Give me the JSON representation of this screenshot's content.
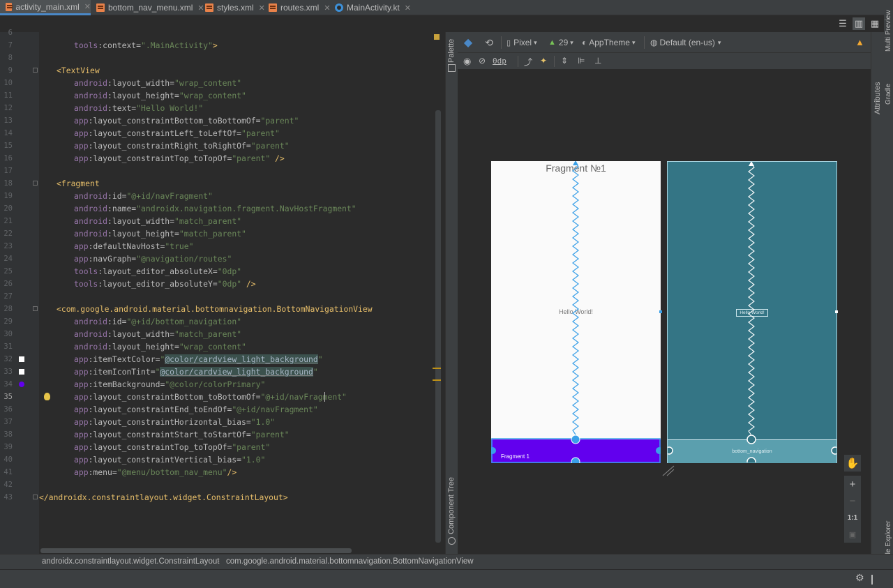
{
  "tabs": [
    {
      "label": "activity_main.xml",
      "icon": "xml-file-icon",
      "active": true
    },
    {
      "label": "bottom_nav_menu.xml",
      "icon": "xml-file-icon",
      "active": false
    },
    {
      "label": "styles.xml",
      "icon": "xml-file-icon",
      "active": false
    },
    {
      "label": "routes.xml",
      "icon": "xml-file-icon",
      "active": false
    },
    {
      "label": "MainActivity.kt",
      "icon": "kotlin-file-icon",
      "active": false
    }
  ],
  "editor": {
    "current_line": "35",
    "lines": [
      {
        "n": "6",
        "segs": []
      },
      {
        "n": "7",
        "segs": [
          [
            "ns",
            "tools"
          ],
          [
            "attr",
            ":context="
          ],
          [
            "val",
            "\".MainActivity\""
          ],
          [
            "tag",
            ">"
          ]
        ]
      },
      {
        "n": "8",
        "segs": []
      },
      {
        "n": "9",
        "segs": [
          [
            "tag",
            "<TextView"
          ]
        ]
      },
      {
        "n": "10",
        "segs": [
          [
            "ns",
            "android"
          ],
          [
            "attr",
            ":layout_width="
          ],
          [
            "val",
            "\"wrap_content\""
          ]
        ]
      },
      {
        "n": "11",
        "segs": [
          [
            "ns",
            "android"
          ],
          [
            "attr",
            ":layout_height="
          ],
          [
            "val",
            "\"wrap_content\""
          ]
        ]
      },
      {
        "n": "12",
        "segs": [
          [
            "ns",
            "android"
          ],
          [
            "attr",
            ":text="
          ],
          [
            "val",
            "\"Hello World!\""
          ]
        ]
      },
      {
        "n": "13",
        "segs": [
          [
            "ns",
            "app"
          ],
          [
            "attr",
            ":layout_constraintBottom_toBottomOf="
          ],
          [
            "val",
            "\"parent\""
          ]
        ]
      },
      {
        "n": "14",
        "segs": [
          [
            "ns",
            "app"
          ],
          [
            "attr",
            ":layout_constraintLeft_toLeftOf="
          ],
          [
            "val",
            "\"parent\""
          ]
        ]
      },
      {
        "n": "15",
        "segs": [
          [
            "ns",
            "app"
          ],
          [
            "attr",
            ":layout_constraintRight_toRightOf="
          ],
          [
            "val",
            "\"parent\""
          ]
        ]
      },
      {
        "n": "16",
        "segs": [
          [
            "ns",
            "app"
          ],
          [
            "attr",
            ":layout_constraintTop_toTopOf="
          ],
          [
            "val",
            "\"parent\""
          ],
          [
            "tag",
            " />"
          ]
        ]
      },
      {
        "n": "17",
        "segs": []
      },
      {
        "n": "18",
        "segs": [
          [
            "tag",
            "<fragment"
          ]
        ]
      },
      {
        "n": "19",
        "segs": [
          [
            "ns",
            "android"
          ],
          [
            "attr",
            ":id="
          ],
          [
            "val",
            "\"@+id/navFragment\""
          ]
        ]
      },
      {
        "n": "20",
        "segs": [
          [
            "ns",
            "android"
          ],
          [
            "attr",
            ":name="
          ],
          [
            "val",
            "\"androidx.navigation.fragment.NavHostFragment\""
          ]
        ]
      },
      {
        "n": "21",
        "segs": [
          [
            "ns",
            "android"
          ],
          [
            "attr",
            ":layout_width="
          ],
          [
            "val",
            "\"match_parent\""
          ]
        ]
      },
      {
        "n": "22",
        "segs": [
          [
            "ns",
            "android"
          ],
          [
            "attr",
            ":layout_height="
          ],
          [
            "val",
            "\"match_parent\""
          ]
        ]
      },
      {
        "n": "23",
        "segs": [
          [
            "ns",
            "app"
          ],
          [
            "attr",
            ":defaultNavHost="
          ],
          [
            "val",
            "\"true\""
          ]
        ]
      },
      {
        "n": "24",
        "segs": [
          [
            "ns",
            "app"
          ],
          [
            "attr",
            ":navGraph="
          ],
          [
            "val",
            "\"@navigation/routes\""
          ]
        ]
      },
      {
        "n": "25",
        "segs": [
          [
            "ns",
            "tools"
          ],
          [
            "attr",
            ":layout_editor_absoluteX="
          ],
          [
            "val",
            "\"0dp\""
          ]
        ]
      },
      {
        "n": "26",
        "segs": [
          [
            "ns",
            "tools"
          ],
          [
            "attr",
            ":layout_editor_absoluteY="
          ],
          [
            "val",
            "\"0dp\""
          ],
          [
            "tag",
            " />"
          ]
        ]
      },
      {
        "n": "27",
        "segs": []
      },
      {
        "n": "28",
        "segs": [
          [
            "tag",
            "<com.google.android.material.bottomnavigation.BottomNavigationView"
          ]
        ]
      },
      {
        "n": "29",
        "segs": [
          [
            "ns",
            "android"
          ],
          [
            "attr",
            ":id="
          ],
          [
            "val",
            "\"@+id/bottom_navigation\""
          ]
        ]
      },
      {
        "n": "30",
        "segs": [
          [
            "ns",
            "android"
          ],
          [
            "attr",
            ":layout_width="
          ],
          [
            "val",
            "\"match_parent\""
          ]
        ]
      },
      {
        "n": "31",
        "segs": [
          [
            "ns",
            "android"
          ],
          [
            "attr",
            ":layout_height="
          ],
          [
            "val",
            "\"wrap_content\""
          ]
        ]
      },
      {
        "n": "32",
        "segs": [
          [
            "ns",
            "app"
          ],
          [
            "attr",
            ":itemTextColor="
          ],
          [
            "val",
            "\""
          ],
          [
            "hl",
            "@color/cardview_light_background"
          ],
          [
            "val",
            "\""
          ]
        ]
      },
      {
        "n": "33",
        "segs": [
          [
            "ns",
            "app"
          ],
          [
            "attr",
            ":itemIconTint="
          ],
          [
            "val",
            "\""
          ],
          [
            "hl",
            "@color/cardview_light_background"
          ],
          [
            "val",
            "\""
          ]
        ]
      },
      {
        "n": "34",
        "segs": [
          [
            "ns",
            "app"
          ],
          [
            "attr",
            ":itemBackground="
          ],
          [
            "val",
            "\"@color/colorPrimary\""
          ]
        ]
      },
      {
        "n": "35",
        "segs": [
          [
            "ns",
            "app"
          ],
          [
            "attr",
            ":layout_constraintBottom_toBottomOf="
          ],
          [
            "val",
            "\"@+id/navFragment\""
          ]
        ]
      },
      {
        "n": "36",
        "segs": [
          [
            "ns",
            "app"
          ],
          [
            "attr",
            ":layout_constraintEnd_toEndOf="
          ],
          [
            "val",
            "\"@+id/navFragment\""
          ]
        ]
      },
      {
        "n": "37",
        "segs": [
          [
            "ns",
            "app"
          ],
          [
            "attr",
            ":layout_constraintHorizontal_bias="
          ],
          [
            "val",
            "\"1.0\""
          ]
        ]
      },
      {
        "n": "38",
        "segs": [
          [
            "ns",
            "app"
          ],
          [
            "attr",
            ":layout_constraintStart_toStartOf="
          ],
          [
            "val",
            "\"parent\""
          ]
        ]
      },
      {
        "n": "39",
        "segs": [
          [
            "ns",
            "app"
          ],
          [
            "attr",
            ":layout_constraintTop_toTopOf="
          ],
          [
            "val",
            "\"parent\""
          ]
        ]
      },
      {
        "n": "40",
        "segs": [
          [
            "ns",
            "app"
          ],
          [
            "attr",
            ":layout_constraintVertical_bias="
          ],
          [
            "val",
            "\"1.0\""
          ]
        ]
      },
      {
        "n": "41",
        "segs": [
          [
            "ns",
            "app"
          ],
          [
            "attr",
            ":menu="
          ],
          [
            "val",
            "\"@menu/bottom_nav_menu\""
          ],
          [
            "tag",
            "/>"
          ]
        ]
      },
      {
        "n": "42",
        "segs": []
      },
      {
        "n": "43",
        "segs": [
          [
            "tag",
            "</androidx.constraintlayout.widget.ConstraintLayout>"
          ]
        ]
      }
    ]
  },
  "gutter_colors": {
    "cardview_light_background": "#ffffff",
    "colorPrimary": "#6200ee"
  },
  "side_panels": {
    "palette": "Palette",
    "component_tree": "Component Tree",
    "attributes": "Attributes",
    "multi_preview": "Multi Preview",
    "gradle": "Gradle",
    "device_file_explorer": "Device File Explorer"
  },
  "design_toolbar": {
    "device": "Pixel",
    "api_level": "29",
    "theme": "AppTheme",
    "locale": "Default (en-us)",
    "margin": "0dp"
  },
  "design_preview": {
    "fragment_title": "Fragment №1",
    "hello_text": "Hello World!",
    "bottom_nav_label": "Fragment 1",
    "bottom_nav_color": "#6200ee"
  },
  "blueprint": {
    "bottom_nav_label": "bottom_navigation",
    "hello_text": "Hello World!"
  },
  "zoom_controls": {
    "zoom_in": "+",
    "zoom_out": "−",
    "one_to_one": "1:1"
  },
  "breadcrumbs": [
    "androidx.constraintlayout.widget.ConstraintLayout",
    "com.google.android.material.bottomnavigation.BottomNavigationView"
  ],
  "colors": {
    "accent": "#4a88c7",
    "blueprint_bg": "#347585",
    "warning": "#f0a732"
  }
}
